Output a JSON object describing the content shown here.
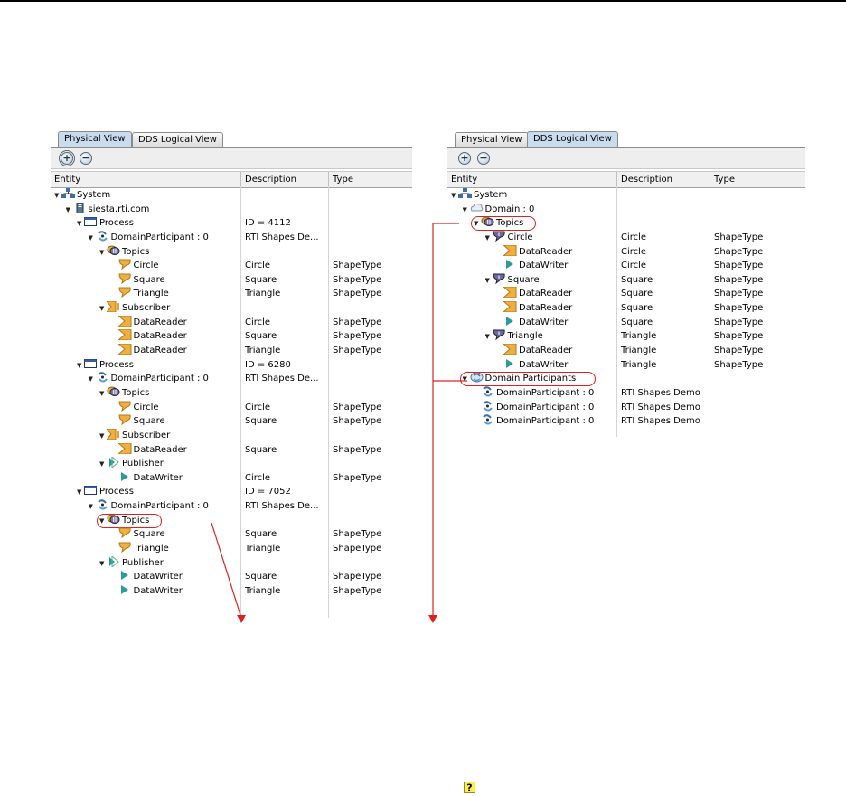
{
  "left_panel": {
    "tabs": [
      {
        "label": "Physical View",
        "active": true
      },
      {
        "label": "DDS Logical View",
        "active": false
      }
    ],
    "toolbar": {
      "expand_symbol": "+",
      "collapse_symbol": "−"
    },
    "columns": [
      "Entity",
      "Description",
      "Type"
    ],
    "rows": [
      {
        "level": 0,
        "toggle": "▼",
        "icon": "system-icon",
        "name": "System",
        "desc": "",
        "type": ""
      },
      {
        "level": 1,
        "toggle": "▼",
        "icon": "host-icon",
        "name": "siesta.rti.com",
        "desc": "",
        "type": ""
      },
      {
        "level": 2,
        "toggle": "▼",
        "icon": "process-icon",
        "name": "Process",
        "desc": "ID = 4112",
        "type": ""
      },
      {
        "level": 3,
        "toggle": "▼",
        "icon": "participant-icon",
        "name": "DomainParticipant : 0",
        "desc": "RTI Shapes De...",
        "type": ""
      },
      {
        "level": 4,
        "toggle": "▼",
        "icon": "topics-icon",
        "name": "Topics",
        "desc": "",
        "type": ""
      },
      {
        "level": 5,
        "toggle": "",
        "icon": "topic-icon",
        "name": "Circle",
        "desc": "Circle",
        "type": "ShapeType"
      },
      {
        "level": 5,
        "toggle": "",
        "icon": "topic-icon",
        "name": "Square",
        "desc": "Square",
        "type": "ShapeType"
      },
      {
        "level": 5,
        "toggle": "",
        "icon": "topic-icon",
        "name": "Triangle",
        "desc": "Triangle",
        "type": "ShapeType"
      },
      {
        "level": 4,
        "toggle": "▼",
        "icon": "subscriber-icon",
        "name": "Subscriber",
        "desc": "",
        "type": ""
      },
      {
        "level": 5,
        "toggle": "",
        "icon": "datareader-icon",
        "name": "DataReader",
        "desc": "Circle",
        "type": "ShapeType"
      },
      {
        "level": 5,
        "toggle": "",
        "icon": "datareader-icon",
        "name": "DataReader",
        "desc": "Square",
        "type": "ShapeType"
      },
      {
        "level": 5,
        "toggle": "",
        "icon": "datareader-icon",
        "name": "DataReader",
        "desc": "Triangle",
        "type": "ShapeType"
      },
      {
        "level": 2,
        "toggle": "▼",
        "icon": "process-icon",
        "name": "Process",
        "desc": "ID = 6280",
        "type": ""
      },
      {
        "level": 3,
        "toggle": "▼",
        "icon": "participant-icon",
        "name": "DomainParticipant : 0",
        "desc": "RTI Shapes De...",
        "type": ""
      },
      {
        "level": 4,
        "toggle": "▼",
        "icon": "topics-icon",
        "name": "Topics",
        "desc": "",
        "type": ""
      },
      {
        "level": 5,
        "toggle": "",
        "icon": "topic-icon",
        "name": "Circle",
        "desc": "Circle",
        "type": "ShapeType"
      },
      {
        "level": 5,
        "toggle": "",
        "icon": "topic-icon",
        "name": "Square",
        "desc": "Square",
        "type": "ShapeType"
      },
      {
        "level": 4,
        "toggle": "▼",
        "icon": "subscriber-icon",
        "name": "Subscriber",
        "desc": "",
        "type": ""
      },
      {
        "level": 5,
        "toggle": "",
        "icon": "datareader-icon",
        "name": "DataReader",
        "desc": "Square",
        "type": "ShapeType"
      },
      {
        "level": 4,
        "toggle": "▼",
        "icon": "publisher-icon",
        "name": "Publisher",
        "desc": "",
        "type": ""
      },
      {
        "level": 5,
        "toggle": "",
        "icon": "datawriter-icon",
        "name": "DataWriter",
        "desc": "Circle",
        "type": "ShapeType"
      },
      {
        "level": 2,
        "toggle": "▼",
        "icon": "process-icon",
        "name": "Process",
        "desc": "ID = 7052",
        "type": ""
      },
      {
        "level": 3,
        "toggle": "▼",
        "icon": "participant-icon",
        "name": "DomainParticipant : 0",
        "desc": "RTI Shapes De...",
        "type": ""
      },
      {
        "level": 4,
        "toggle": "▼",
        "icon": "topics-icon",
        "name": "Topics",
        "desc": "",
        "type": "",
        "highlight": true
      },
      {
        "level": 5,
        "toggle": "",
        "icon": "topic-icon",
        "name": "Square",
        "desc": "Square",
        "type": "ShapeType"
      },
      {
        "level": 5,
        "toggle": "",
        "icon": "topic-icon",
        "name": "Triangle",
        "desc": "Triangle",
        "type": "ShapeType"
      },
      {
        "level": 4,
        "toggle": "▼",
        "icon": "publisher-icon",
        "name": "Publisher",
        "desc": "",
        "type": ""
      },
      {
        "level": 5,
        "toggle": "",
        "icon": "datawriter-icon",
        "name": "DataWriter",
        "desc": "Square",
        "type": "ShapeType"
      },
      {
        "level": 5,
        "toggle": "",
        "icon": "datawriter-icon",
        "name": "DataWriter",
        "desc": "Triangle",
        "type": "ShapeType"
      }
    ]
  },
  "right_panel": {
    "tabs": [
      {
        "label": "Physical View",
        "active": false
      },
      {
        "label": "DDS Logical View",
        "active": true
      }
    ],
    "toolbar": {
      "expand_symbol": "+",
      "collapse_symbol": "−"
    },
    "columns": [
      "Entity",
      "Description",
      "Type"
    ],
    "rows": [
      {
        "level": 0,
        "toggle": "▼",
        "icon": "system-icon",
        "name": "System",
        "desc": "",
        "type": ""
      },
      {
        "level": 1,
        "toggle": "▼",
        "icon": "domain-icon",
        "name": "Domain : 0",
        "desc": "",
        "type": ""
      },
      {
        "level": 2,
        "toggle": "▼",
        "icon": "topics-icon",
        "name": "Topics",
        "desc": "",
        "type": "",
        "highlight": true
      },
      {
        "level": 3,
        "toggle": "▼",
        "icon": "topic-dark-icon",
        "name": "Circle",
        "desc": "Circle",
        "type": "ShapeType"
      },
      {
        "level": 4,
        "toggle": "",
        "icon": "datareader-icon",
        "name": "DataReader",
        "desc": "Circle",
        "type": "ShapeType"
      },
      {
        "level": 4,
        "toggle": "",
        "icon": "datawriter-icon",
        "name": "DataWriter",
        "desc": "Circle",
        "type": "ShapeType"
      },
      {
        "level": 3,
        "toggle": "▼",
        "icon": "topic-dark-icon",
        "name": "Square",
        "desc": "Square",
        "type": "ShapeType"
      },
      {
        "level": 4,
        "toggle": "",
        "icon": "datareader-icon",
        "name": "DataReader",
        "desc": "Square",
        "type": "ShapeType"
      },
      {
        "level": 4,
        "toggle": "",
        "icon": "datareader-icon",
        "name": "DataReader",
        "desc": "Square",
        "type": "ShapeType"
      },
      {
        "level": 4,
        "toggle": "",
        "icon": "datawriter-icon",
        "name": "DataWriter",
        "desc": "Square",
        "type": "ShapeType"
      },
      {
        "level": 3,
        "toggle": "▼",
        "icon": "topic-dark-icon",
        "name": "Triangle",
        "desc": "Triangle",
        "type": "ShapeType"
      },
      {
        "level": 4,
        "toggle": "",
        "icon": "datareader-icon",
        "name": "DataReader",
        "desc": "Triangle",
        "type": "ShapeType"
      },
      {
        "level": 4,
        "toggle": "",
        "icon": "datawriter-icon",
        "name": "DataWriter",
        "desc": "Triangle",
        "type": "ShapeType"
      },
      {
        "level": 1,
        "toggle": "▼",
        "icon": "participants-icon",
        "name": "Domain Participants",
        "desc": "",
        "type": "",
        "highlight": true
      },
      {
        "level": 2,
        "toggle": "",
        "icon": "participant-icon",
        "name": "DomainParticipant : 0",
        "desc": "RTI Shapes Demo",
        "type": ""
      },
      {
        "level": 2,
        "toggle": "",
        "icon": "participant-icon",
        "name": "DomainParticipant : 0",
        "desc": "RTI Shapes Demo",
        "type": ""
      },
      {
        "level": 2,
        "toggle": "",
        "icon": "participant-icon",
        "name": "DomainParticipant : 0",
        "desc": "RTI Shapes Demo",
        "type": ""
      }
    ]
  },
  "colors": {
    "annotation_red": "#e02020",
    "active_tab": "#c8dcee",
    "topic_orange": "#f0b040",
    "writer_teal": "#2a9a9a"
  },
  "footer_icon": "help-question-icon"
}
